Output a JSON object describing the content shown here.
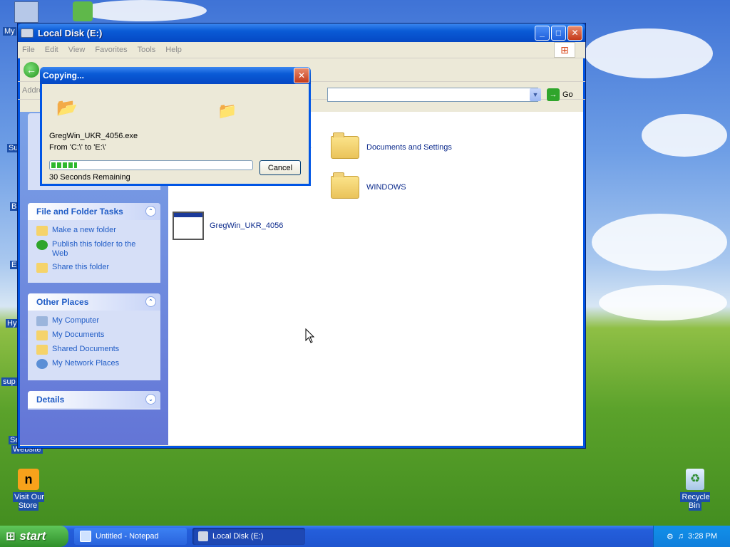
{
  "desktop": {
    "icons": [
      {
        "label": "My",
        "name": "my-computer-icon"
      },
      {
        "label": "Website",
        "name": "website-icon"
      },
      {
        "label": "Visit Our Store",
        "name": "visit-our-store-icon"
      },
      {
        "label": "Recycle Bin",
        "name": "recycle-bin-icon"
      }
    ],
    "partial_labels": [
      "Su",
      "B",
      "E",
      "Hy",
      "sup",
      "Se"
    ]
  },
  "explorer": {
    "title": "Local Disk (E:)",
    "menu": [
      "File",
      "Edit",
      "View",
      "Favorites",
      "Tools",
      "Help"
    ],
    "address_label": "Addre",
    "go_label": "Go",
    "task_panes": {
      "file_folder_tasks": {
        "header": "File and Folder Tasks",
        "items": [
          "Make a new folder",
          "Publish this folder to the Web",
          "Share this folder"
        ]
      },
      "other_places": {
        "header": "Other Places",
        "items": [
          "My Computer",
          "My Documents",
          "Shared Documents",
          "My Network Places"
        ]
      },
      "details": {
        "header": "Details"
      }
    },
    "files": [
      {
        "name": "Documents and Settings",
        "type": "folder"
      },
      {
        "name": "WINDOWS",
        "type": "folder"
      },
      {
        "name": "GregWin_UKR_4056",
        "type": "exe"
      }
    ],
    "partial_file_label": "..."
  },
  "copy_dialog": {
    "title": "Copying...",
    "filename": "GregWin_UKR_4056.exe",
    "from_to": "From 'C:\\' to 'E:\\'",
    "remaining": "30 Seconds Remaining",
    "cancel_label": "Cancel",
    "progress": 0.13
  },
  "taskbar": {
    "start_label": "start",
    "tasks": [
      {
        "label": "Untitled - Notepad",
        "active": false
      },
      {
        "label": "Local Disk (E:)",
        "active": true
      }
    ],
    "clock": "3:28 PM"
  }
}
